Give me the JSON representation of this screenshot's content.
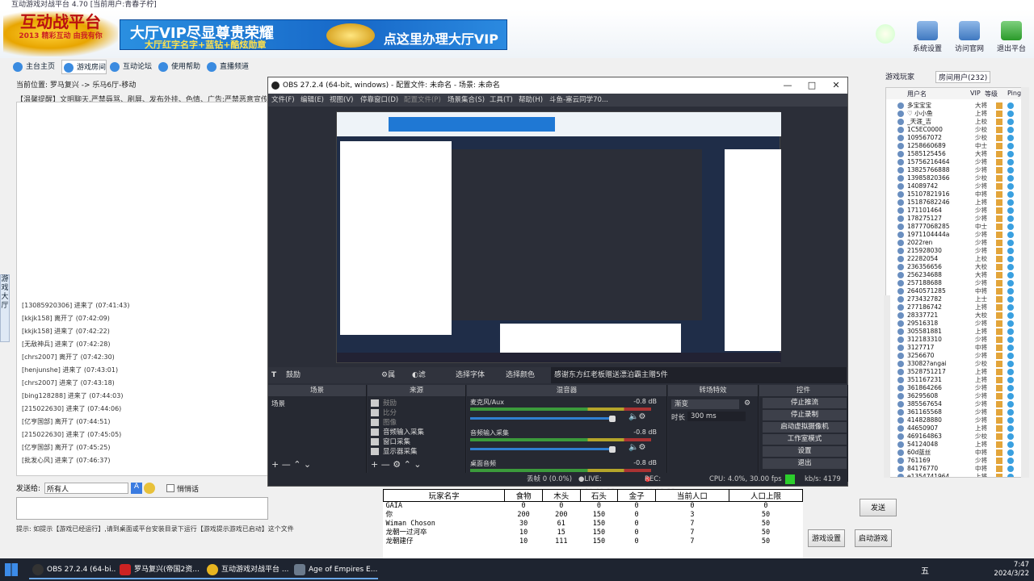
{
  "platform_title": "互动游戏对战平台 4.70 [当前用户:青春子柠]",
  "banner": {
    "logo_text": "互动战平台",
    "logo_sub": "2013 精彩互动 由我有你",
    "vip_line1": "大厅VIP尽显尊贵荣耀",
    "vip_line2": "大厅红字名字+蓝钻+酷炫勋章",
    "vip_cta": "点这里办理大厅VIP",
    "buttons": [
      "系统设置",
      "访问官网",
      "退出平台"
    ]
  },
  "tabs": [
    "主台主页",
    "游戏房间",
    "互动论坛",
    "使用帮助",
    "直播频道"
  ],
  "location": "当前位置: 罗马复兴 -> 乐马6厅-移动",
  "notice": "【温馨提醒】文明聊天,严禁辱骂、刷屏、发布外挂、色情、广告;严禁恶意宣传平台",
  "side_tab": "游戏大厅",
  "chat": [
    "[13085920306] 进来了 (07:41:43)",
    "[kkjk158] 离开了 (07:42:09)",
    "[kkjk158] 进来了 (07:42:22)",
    "[无敌神兵] 进来了 (07:42:28)",
    "[chrs2007] 离开了 (07:42:30)",
    "[henjunshe] 进来了 (07:43:01)",
    "[chrs2007] 进来了 (07:43:18)",
    "[bing128288] 进来了 (07:44:03)",
    "[215022630] 进来了 (07:44:06)",
    "[亿亨国部] 离开了 (07:44:51)",
    "[215022630] 进来了 (07:45:05)",
    "[亿亨国部] 离开了 (07:45:25)",
    "[批发心风] 进来了 (07:46:37)"
  ],
  "send": {
    "label": "发送给:",
    "target": "所有人",
    "private": "悄悄话"
  },
  "tip": "提示: 如提示【游戏已经运行】,请到桌面或平台安装目录下运行【游戏提示游戏已启动】这个文件",
  "obs": {
    "title": "OBS 27.2.4 (64-bit, windows) - 配置文件: 未命名 - 场景: 未命名",
    "menu": [
      "文件(F)",
      "编辑(E)",
      "视图(V)",
      "停靠窗口(D)",
      "配置文件(P)",
      "场景集合(S)",
      "工具(T)",
      "帮助(H)",
      "斗鱼-塞云同学70..."
    ],
    "context": {
      "source": "鼓励",
      "props": "属性",
      "filters": "滤镜",
      "font": "选择字体",
      "color": "选择颜色",
      "text": "感谢东方红老板赠送漂泊霸主赠5件"
    },
    "panels": {
      "scenes": "场景",
      "sources": "来源",
      "mixer": "混音器",
      "transitions": "转场特效",
      "controls": "控件"
    },
    "scene_item": "场景",
    "sources": [
      "鼓励",
      "比分",
      "图像",
      "音频输入采集",
      "窗口采集",
      "显示器采集"
    ],
    "mixer": [
      {
        "name": "麦克风/Aux",
        "db": "-0.8 dB"
      },
      {
        "name": "音频输入采集",
        "db": "-0.8 dB"
      },
      {
        "name": "桌面音频",
        "db": "-0.8 dB"
      }
    ],
    "transition": {
      "type": "渐变",
      "duration_label": "时长",
      "duration": "300 ms"
    },
    "controls": [
      "停止推流",
      "停止录制",
      "启动虚拟摄像机",
      "工作室模式",
      "设置",
      "退出"
    ],
    "status": {
      "dropped": "丢帧 0 (0.0%)",
      "live": "LIVE: 00:02:32",
      "rec": "REC: 00:02:32",
      "cpu": "CPU: 4.0%, 30.00 fps",
      "kbps": "kb/s: 4179"
    }
  },
  "score_table": {
    "headers": [
      "玩家名字",
      "食物",
      "木头",
      "石头",
      "金子",
      "当前人口",
      "人口上限"
    ],
    "rows": [
      [
        "GAIA",
        "0",
        "0",
        "0",
        "0",
        "0",
        "0"
      ],
      [
        "你",
        "200",
        "200",
        "150",
        "0",
        "3",
        "50"
      ],
      [
        "Wiman Choson",
        "30",
        "61",
        "150",
        "0",
        "7",
        "50"
      ],
      [
        "龙朝一过河卒",
        "10",
        "15",
        "150",
        "0",
        "7",
        "50"
      ],
      [
        "龙朝建仔",
        "10",
        "111",
        "150",
        "0",
        "7",
        "50"
      ]
    ]
  },
  "right": {
    "tabs": [
      "游戏玩家",
      "房间用户(232)"
    ],
    "columns": [
      "用户名",
      "VIP",
      "等级",
      "",
      "Ping"
    ],
    "users": [
      {
        "name": "多宝宝宝",
        "rank": "大将"
      },
      {
        "name": "♡ 小小鱼",
        "rank": "上将"
      },
      {
        "name": "_天涯_吉",
        "rank": "上校"
      },
      {
        "name": "1C5EC0000",
        "rank": "少校"
      },
      {
        "name": "109567072",
        "rank": "少校"
      },
      {
        "name": "1258660689",
        "rank": "中士"
      },
      {
        "name": "1585125456",
        "rank": "大将"
      },
      {
        "name": "15756216464",
        "rank": "少将"
      },
      {
        "name": "13825766888",
        "rank": "少将"
      },
      {
        "name": "13985820366",
        "rank": "少校"
      },
      {
        "name": "14089742",
        "rank": "少将"
      },
      {
        "name": "15107821916",
        "rank": "中将"
      },
      {
        "name": "15187682246",
        "rank": "上将"
      },
      {
        "name": "171101464",
        "rank": "少将"
      },
      {
        "name": "178275127",
        "rank": "少将"
      },
      {
        "name": "18777068285",
        "rank": "中士"
      },
      {
        "name": "1971104444a",
        "rank": "少将"
      },
      {
        "name": "2022ren",
        "rank": "少将"
      },
      {
        "name": "215928030",
        "rank": "少将"
      },
      {
        "name": "22282054",
        "rank": "上校"
      },
      {
        "name": "236356656",
        "rank": "大校"
      },
      {
        "name": "256234688",
        "rank": "大将"
      },
      {
        "name": "257188688",
        "rank": "少将"
      },
      {
        "name": "2640571285",
        "rank": "中将"
      },
      {
        "name": "273432782",
        "rank": "上士"
      },
      {
        "name": "277186742",
        "rank": "上将"
      },
      {
        "name": "28337721",
        "rank": "大校"
      },
      {
        "name": "29516318",
        "rank": "少将"
      },
      {
        "name": "305581881",
        "rank": "上将"
      },
      {
        "name": "312183310",
        "rank": "少将"
      },
      {
        "name": "3127717",
        "rank": "中将"
      },
      {
        "name": "3256670",
        "rank": "少将"
      },
      {
        "name": "33082?angai",
        "rank": "少校"
      },
      {
        "name": "3528751217",
        "rank": "上将"
      },
      {
        "name": "351167231",
        "rank": "上将"
      },
      {
        "name": "361864266",
        "rank": "少将"
      },
      {
        "name": "36295608",
        "rank": "少将"
      },
      {
        "name": "385567654",
        "rank": "少将"
      },
      {
        "name": "361165568",
        "rank": "少将"
      },
      {
        "name": "414828880",
        "rank": "少将"
      },
      {
        "name": "44650907",
        "rank": "上将"
      },
      {
        "name": "469164863",
        "rank": "少校"
      },
      {
        "name": "54124048",
        "rank": "上将"
      },
      {
        "name": "60d蓝丝",
        "rank": "中将"
      },
      {
        "name": "761169",
        "rank": "少将"
      },
      {
        "name": "84176770",
        "rank": "中将"
      },
      {
        "name": "e1354741964",
        "rank": "上将"
      }
    ],
    "send_button": "发送",
    "bottom_buttons": [
      "游戏设置",
      "启动游戏"
    ]
  },
  "taskbar": {
    "items": [
      "OBS 27.2.4 (64-bi...",
      "罗马复兴(帝国2资...",
      "互动游戏对战平台 ...",
      "Age of Empires E..."
    ],
    "time": "7:47",
    "date": "2024/3/22",
    "ime": "五"
  }
}
